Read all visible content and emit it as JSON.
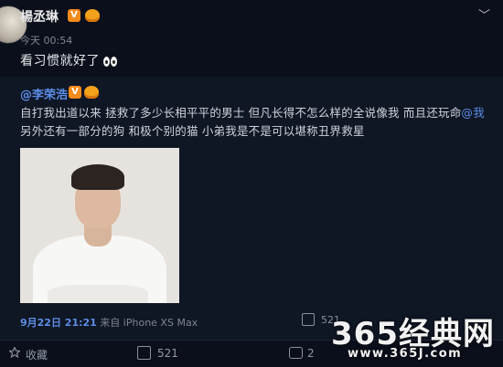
{
  "post": {
    "username": "楊丞琳",
    "time": "今天 00:54",
    "text": "看习惯就好了"
  },
  "repost": {
    "author": "@李荣浩",
    "text_before_mention": "自打我出道以来 拯救了多少长相平平的男士 但凡长得不怎么样的全说像我 而且还玩命",
    "mention": "@我",
    "text_after_mention": " 另外还有一部分的狗 和极个别的猫  小弟我是不是可以堪称丑界救星",
    "date": "9月22日 21:21",
    "source": "来自 iPhone XS Max",
    "repost_count": "521"
  },
  "actions": {
    "favorite_label": "收藏",
    "repost_count": "521",
    "comment_count": "2"
  },
  "watermark": {
    "title": "365经典网",
    "url": "www.365J.com"
  },
  "icons": {
    "verified": "verified-v-icon",
    "crown": "crown-icon",
    "chevron": "chevron-down-icon",
    "favorite": "star-icon",
    "repost": "repost-icon",
    "comment": "comment-icon"
  },
  "colors": {
    "background": "#0b0f1b",
    "repost_background": "#0f1624",
    "link": "#5d8de6",
    "verified_badge": "#f48b1b"
  }
}
